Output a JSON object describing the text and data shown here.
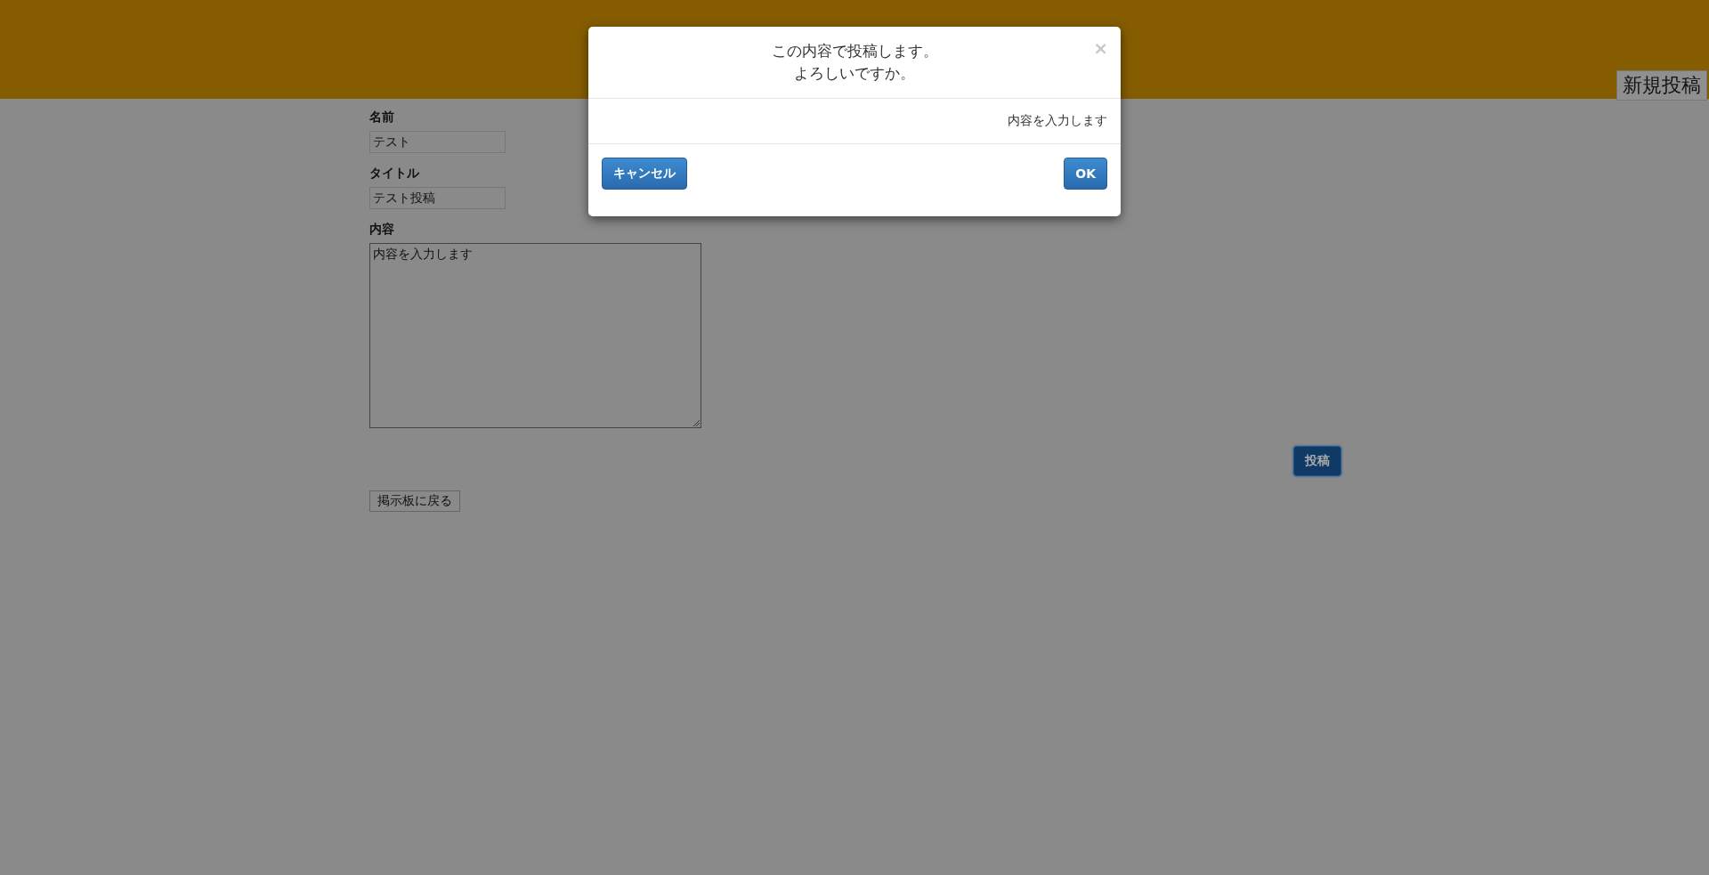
{
  "header": {
    "new_post_button": "新規投稿"
  },
  "form": {
    "fields": [
      {
        "kind": "input",
        "label": "名前",
        "value": "テスト"
      },
      {
        "kind": "input",
        "label": "タイトル",
        "value": "テスト投稿"
      },
      {
        "kind": "textarea",
        "label": "内容",
        "value": "内容を入力します"
      }
    ],
    "submit_button": "投稿",
    "back_button": "掲示板に戻る"
  },
  "modal": {
    "close": "×",
    "message": [
      "この内容で投稿します。",
      "よろしいですか。"
    ],
    "body": "内容を入力します",
    "cancel_button": "キャンセル",
    "ok_button": "OK"
  }
}
